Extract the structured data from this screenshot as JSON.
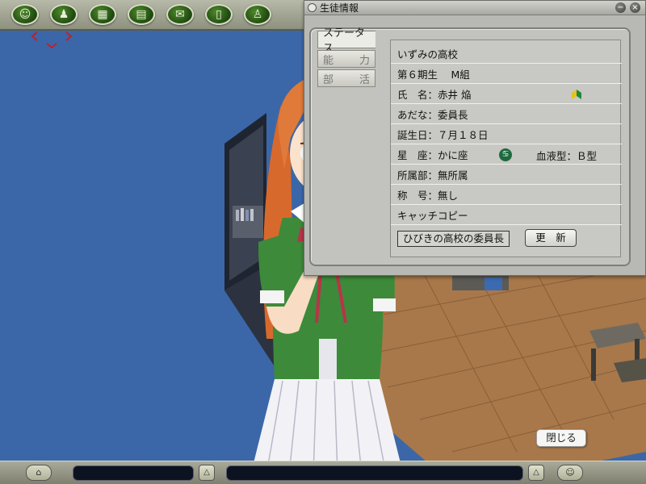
{
  "window": {
    "title": "生徒情報",
    "minimize_label": "−",
    "close_label": "×"
  },
  "tabs": [
    {
      "label_a": "ステータス",
      "label_b": ""
    },
    {
      "label_a": "能",
      "label_b": "力"
    },
    {
      "label_a": "部",
      "label_b": "活"
    }
  ],
  "student": {
    "school": "いずみの高校",
    "class_line": "第６期生　 M組",
    "name_line": "氏　名：赤井 焔",
    "nickname_line": "あだな：委員長",
    "birthday_line": "誕生日：７月１８日",
    "zodiac_line": "星　座：かに座",
    "zodiac_icon_label": "♋",
    "blood_type_line": "血液型：Ｂ型",
    "club_line": "所属部：無所属",
    "title_line": "称　号：無し",
    "catch_copy_label": "キャッチコピー",
    "catch_copy_value": "ひびきの高校の委員長"
  },
  "buttons": {
    "update": "更　新",
    "close": "閉じる"
  },
  "bottom_bar": {
    "chat_label": "⌂",
    "up_left": "△",
    "up_right": "△",
    "face_label": "☺"
  },
  "toolbar_icons": [
    {
      "name": "student-list-icon",
      "glyph": "☺"
    },
    {
      "name": "people-icon",
      "glyph": "♟"
    },
    {
      "name": "event-icon",
      "glyph": "▦"
    },
    {
      "name": "building-icon",
      "glyph": "▤"
    },
    {
      "name": "communication-icon",
      "glyph": "✉"
    },
    {
      "name": "phone-icon",
      "glyph": "▯"
    },
    {
      "name": "group-icon",
      "glyph": "♙"
    }
  ],
  "colors": {
    "sky_blue": "#3b67a8",
    "floor": "#a8784a",
    "toolbar_green": "#2f6a1c",
    "uniform_green": "#3d8a3a",
    "hair": "#e07a3a"
  }
}
